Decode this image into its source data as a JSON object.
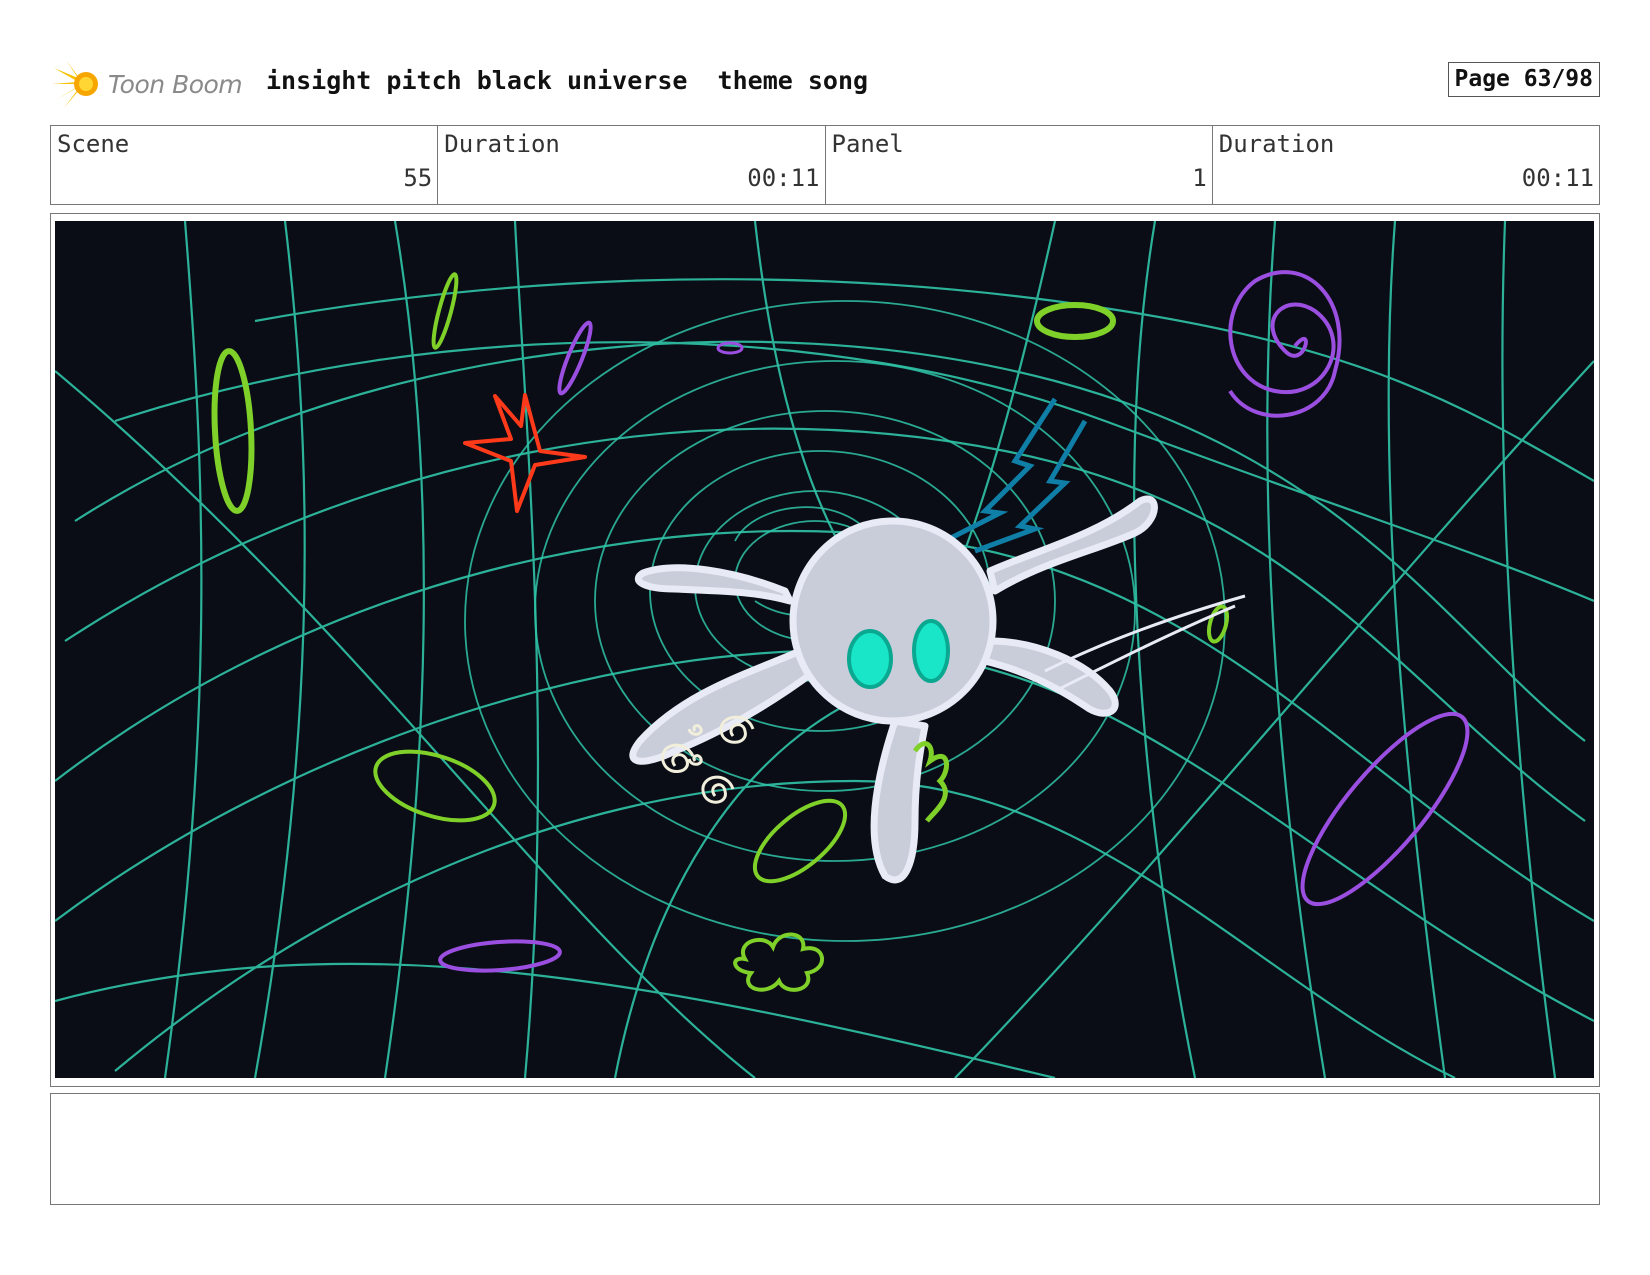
{
  "header": {
    "logo_text": "Toon Boom",
    "title": "insight pitch black universe  theme song",
    "page_label": "Page 63/98"
  },
  "info": {
    "scene_label": "Scene",
    "scene_value": "55",
    "scene_duration_label": "Duration",
    "scene_duration_value": "00:11",
    "panel_label": "Panel",
    "panel_value": "1",
    "panel_duration_label": "Duration",
    "panel_duration_value": "00:11"
  },
  "panel": {
    "background_color": "#0b0d16",
    "grid_color": "#2fc4a8",
    "accent_colors": {
      "green": "#7fd12a",
      "purple": "#9b4fe0",
      "red": "#ff3a1a",
      "blue": "#0f7fa8",
      "character": "#c9ccd9",
      "eyes": "#19e6c8"
    }
  },
  "notes": {}
}
